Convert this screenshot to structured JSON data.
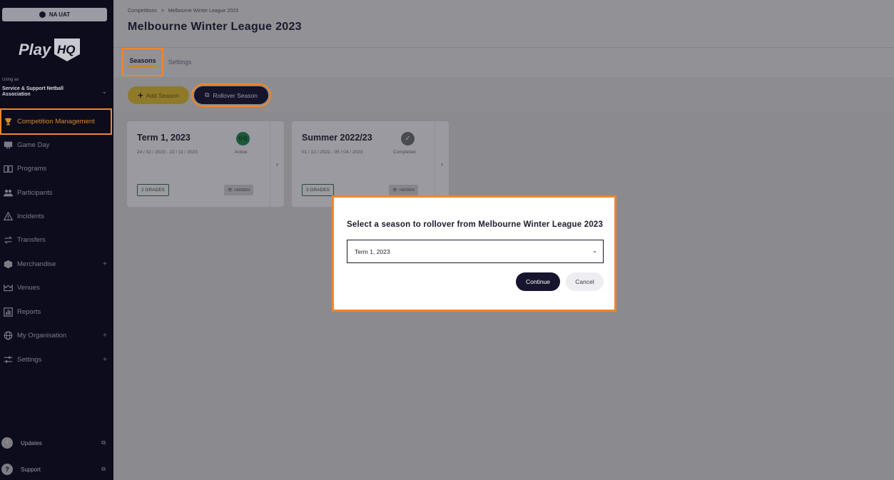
{
  "sidebar": {
    "env_badge": "NA UAT",
    "logo_text": "PlayHQ",
    "using_as_label": "Using as",
    "org_name": "Service & Support Netball Association",
    "nav": [
      {
        "label": "Competition Management",
        "icon": "trophy-icon",
        "active": true
      },
      {
        "label": "Game Day",
        "icon": "scoreboard-icon"
      },
      {
        "label": "Programs",
        "icon": "book-icon"
      },
      {
        "label": "Participants",
        "icon": "people-icon"
      },
      {
        "label": "Incidents",
        "icon": "warning-icon"
      },
      {
        "label": "Transfers",
        "icon": "arrows-icon"
      },
      {
        "label": "Merchandise",
        "icon": "box-icon",
        "expandable": true
      },
      {
        "label": "Venues",
        "icon": "stadium-icon"
      },
      {
        "label": "Reports",
        "icon": "chart-icon"
      },
      {
        "label": "My Organisation",
        "icon": "globe-icon",
        "expandable": true
      },
      {
        "label": "Settings",
        "icon": "sliders-icon",
        "expandable": true
      }
    ],
    "updates_label": "Updates",
    "updates_badge": "1",
    "support_label": "Support"
  },
  "header": {
    "breadcrumb_root": "Competitions",
    "breadcrumb_sep": ">",
    "breadcrumb_current": "Melbourne Winter League 2023",
    "title": "Melbourne Winter League 2023"
  },
  "tabs": {
    "seasons": "Seasons",
    "settings": "Settings"
  },
  "actions": {
    "add_season": "Add Season",
    "rollover_season": "Rollover Season"
  },
  "seasons": [
    {
      "name": "Term 1, 2023",
      "dates": "24 / 02 / 2023 - 22 / 11 / 2023",
      "status": "Active",
      "grades": "2 GRADES",
      "visibility": "HIDDEN"
    },
    {
      "name": "Summer 2022/23",
      "dates": "01 / 12 / 2022 - 05 / 04 / 2023",
      "status": "Completed",
      "grades": "3 GRADES",
      "visibility": "HIDDEN"
    }
  ],
  "modal": {
    "title": "Select a season to rollover from Melbourne Winter League 2023",
    "selected_season": "Term 1, 2023",
    "continue_label": "Continue",
    "cancel_label": "Cancel"
  },
  "colors": {
    "sidebar_bg": "#0d0c1d",
    "highlight": "#f0862b",
    "primary_button": "#17142e",
    "active_status": "#1c7a4a"
  }
}
